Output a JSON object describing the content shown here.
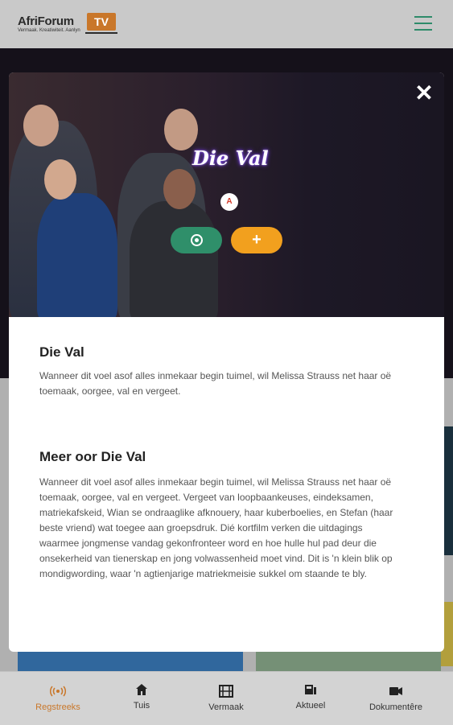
{
  "app": {
    "brand": "AfriForum",
    "brand_tv": "TV",
    "tagline": "Vermaak. Kreatiwiteit. Aanlyn",
    "accent": "#2e8b6a",
    "orange": "#f2a01e"
  },
  "modal": {
    "hero_title": "Die Val",
    "rating": "A",
    "title": "Die Val",
    "summary": "Wanneer dit voel asof alles inmekaar begin tuimel, wil Melissa Strauss net haar oë toemaak, oorgee, val en vergeet.",
    "more_heading": "Meer oor Die Val",
    "more_text": "Wanneer dit voel asof alles inmekaar begin tuimel, wil Melissa Strauss net haar oë toemaak, oorgee, val en vergeet. Vergeet van loopbaankeuses, eindeksamen, matriekafskeid, Wian se ondraaglike afknouery, haar kuberboelies, en Stefan (haar beste vriend) wat toegee aan groepsdruk. Dié kortfilm verken die uitdagings waarmee jongmense vandag gekonfronteer word en hoe hulle hul pad deur die onsekerheid van tienerskap en jong volwassenheid moet vind. Dit is 'n klein blik op mondigwording, waar 'n agtienjarige matriekmeisie sukkel om staande te bly.",
    "add_label": "+",
    "close_label": "✕"
  },
  "nav": {
    "items": [
      {
        "label": "Regstreeks",
        "icon": "broadcast-icon"
      },
      {
        "label": "Tuis",
        "icon": "home-icon"
      },
      {
        "label": "Vermaak",
        "icon": "film-icon"
      },
      {
        "label": "Aktueel",
        "icon": "news-icon"
      },
      {
        "label": "Dokumentêre",
        "icon": "camera-icon"
      }
    ],
    "active_color": "#c9772a"
  }
}
